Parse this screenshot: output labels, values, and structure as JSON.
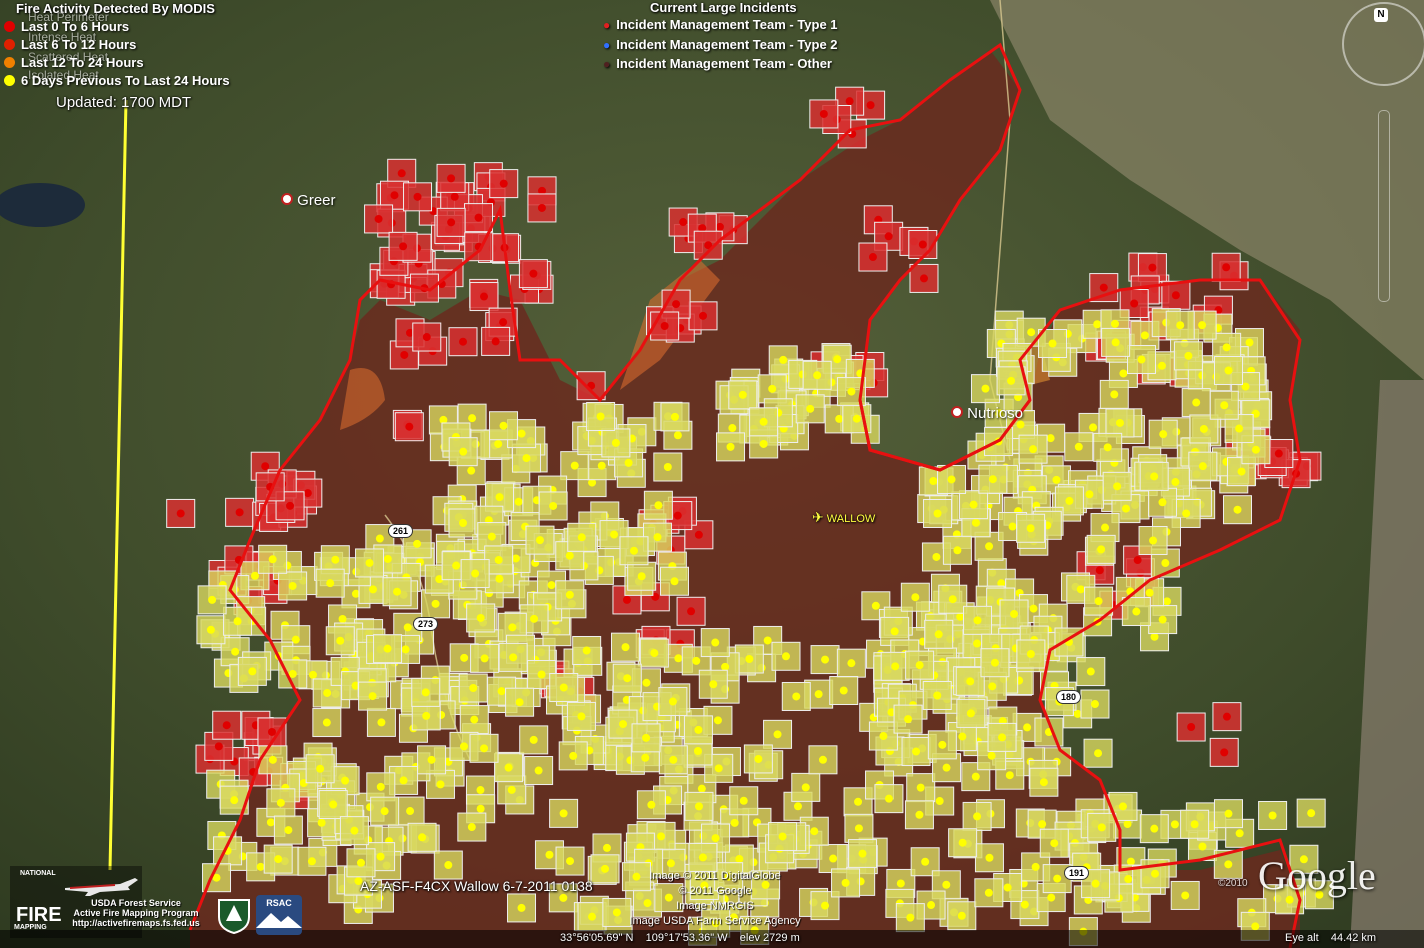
{
  "legend": {
    "title": "Fire Activity Detected By MODIS",
    "perimeter_overlay": [
      "Heat Perimeter",
      "Intense Heat",
      "Scattered Heat",
      "Isolated Heat"
    ],
    "items": [
      {
        "label": "Last 0 To 6 Hours",
        "color": "#e00000"
      },
      {
        "label": "Last 6 To 12 Hours",
        "color": "#e02000"
      },
      {
        "label": "Last 12 To 24 Hours",
        "color": "#f08000"
      },
      {
        "label": "6 Days Previous To Last 24 Hours",
        "color": "#ffff00"
      }
    ],
    "updated": "Updated: 1700 MDT"
  },
  "incidents": {
    "title": "Current Large Incidents",
    "items": [
      {
        "label": "Incident Management Team - Type 1",
        "icon": "red-pin-icon",
        "color": "#e02020"
      },
      {
        "label": "Incident Management Team - Type 2",
        "icon": "blue-pin-icon",
        "color": "#3070ff"
      },
      {
        "label": "Incident Management Team - Other",
        "icon": "dark-pin-icon",
        "color": "#502020"
      }
    ]
  },
  "places": {
    "greer": "Greer",
    "nutrioso": "Nutrioso",
    "fire_name": "WALLOW"
  },
  "routes": {
    "r261": "261",
    "r273": "273",
    "r180": "180",
    "r191": "191"
  },
  "footer": {
    "image_title": "AZ-ASF-F4CX Wallow 6-7-2011 0138",
    "credit_1": "Image © 2011 DigitalGlobe",
    "credit_2": "© 2011 Google",
    "credit_3": "Image NMRGIS",
    "credit_4": "Image USDA Farm Service Agency",
    "coordinates": "33°56'05.69\" N    109°17'53.36\" W    elev 2729 m",
    "eye_alt": "Eye alt    44.42 km",
    "copyright_year": "©2010",
    "google": "Google",
    "usfs_lines": [
      "USDA Forest Service",
      "Active Fire Mapping Program",
      "http://activefiremaps.fs.fed.us"
    ],
    "nfp_top": "NATIONAL",
    "nfp_fire": "FIRE",
    "nfp_bottom": "MAPPING",
    "rsac": "RSAC"
  },
  "compass": {
    "north": "N"
  },
  "colors": {
    "burn_area": "#6a2a1e",
    "perimeter": "#e81010",
    "recent_pixel": "#d83030",
    "old_pixel": "#d8d860",
    "hot_pixel": "#e08a20",
    "boundary_line": "#ffff33"
  }
}
